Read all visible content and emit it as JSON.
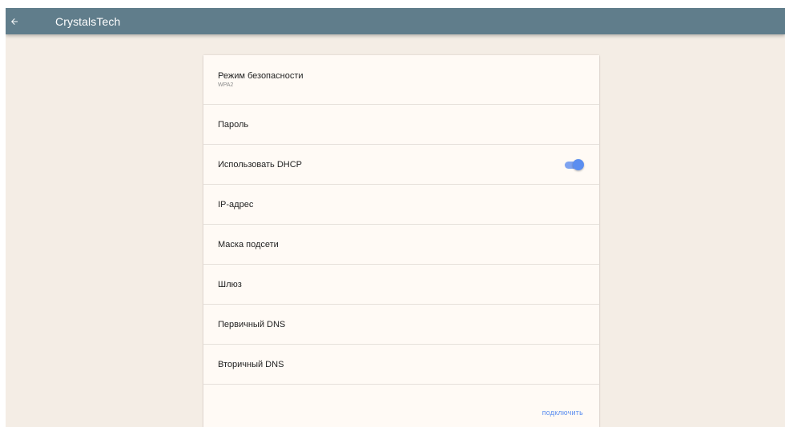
{
  "appbar": {
    "back_icon": "arrow-left-icon",
    "title": "CrystalsTech"
  },
  "settings": {
    "security_mode": {
      "label": "Режим безопасности",
      "value": "WPA2"
    },
    "password": {
      "label": "Пароль"
    },
    "use_dhcp": {
      "label": "Использовать DHCP",
      "enabled": true
    },
    "ip_address": {
      "label": "IP-адрес"
    },
    "subnet_mask": {
      "label": "Маска подсети"
    },
    "gateway": {
      "label": "Шлюз"
    },
    "primary_dns": {
      "label": "Первичный DNS"
    },
    "secondary_dns": {
      "label": "Вторичный DNS"
    }
  },
  "actions": {
    "connect_label": "подключить"
  },
  "colors": {
    "appbar": "#607d8b",
    "background": "#f4ede5",
    "card": "#fffaf5",
    "accent": "#5b8ef0"
  }
}
